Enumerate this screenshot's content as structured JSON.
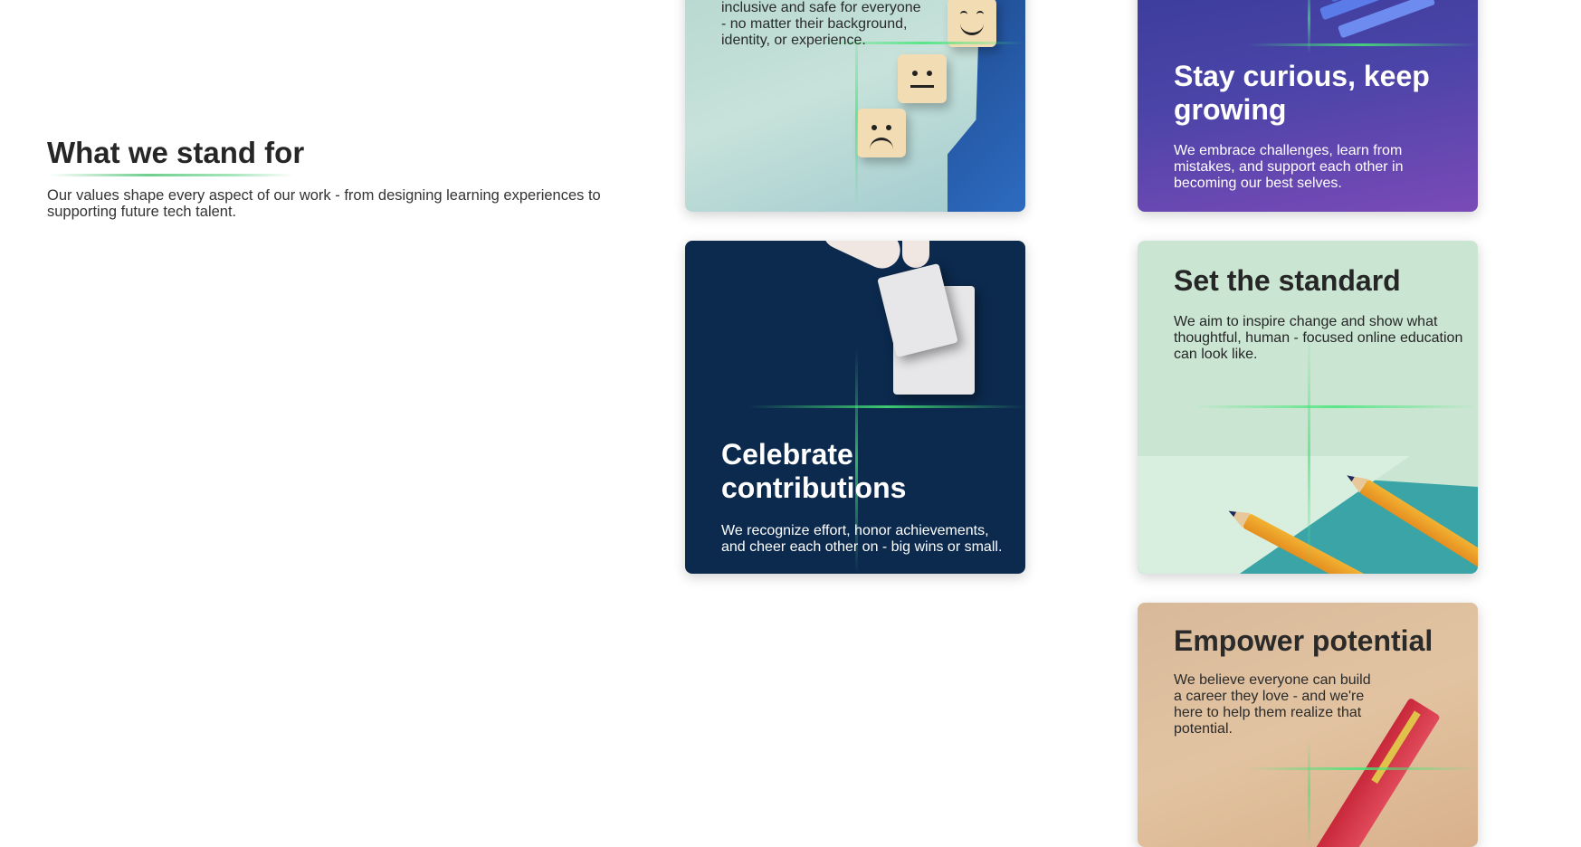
{
  "intro": {
    "title": "What we stand for",
    "description": "Our values shape every aspect of our work - from designing learning experiences to supporting future tech talent."
  },
  "cards": [
    {
      "title": "",
      "description": "inclusive and safe for everyone - no matter their background, identity, or experience."
    },
    {
      "title": "Stay curious, keep growing",
      "description": "We embrace challenges, learn from mistakes, and support each other in becoming our best selves."
    },
    {
      "title": "Celebrate contributions",
      "description": "We recognize effort, honor achievements, and cheer each other on - big wins or small."
    },
    {
      "title": "Set the standard",
      "description": "We aim to inspire change and show what thoughtful, human - focused online education can look like."
    },
    {
      "title": "Empower potential",
      "description": "We believe everyone can build a career they love - and we're here to help them realize that potential."
    }
  ],
  "colors": {
    "accent": "#6fcf8d",
    "navy": "#0c2a4e",
    "purple": "#4b44a8",
    "mint": "#cae6d2",
    "tan": "#d8b99a"
  },
  "icons": [
    "smiley-block-icon",
    "neutral-block-icon",
    "sad-block-icon",
    "puzzle-illustration",
    "pencil-illustration",
    "books-illustration"
  ]
}
